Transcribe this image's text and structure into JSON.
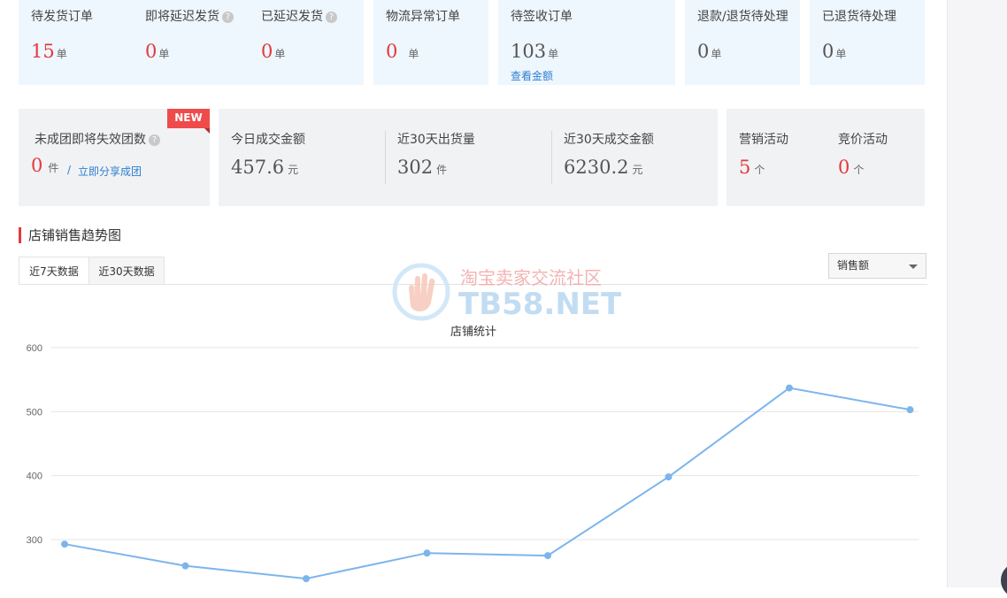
{
  "order_stats": [
    {
      "label": "待发货订单",
      "value": "15",
      "unit": "单",
      "help": false,
      "color": "red"
    },
    {
      "label": "即将延迟发货",
      "value": "0",
      "unit": "单",
      "help": true,
      "color": "red"
    },
    {
      "label": "已延迟发货",
      "value": "0",
      "unit": "单",
      "help": true,
      "color": "red"
    },
    {
      "label": "物流异常订单",
      "value": "0",
      "unit": "单",
      "help": false,
      "color": "red"
    },
    {
      "label": "待签收订单",
      "value": "103",
      "unit": "单",
      "help": false,
      "color": "gray",
      "link": "查看金额"
    },
    {
      "label": "退款/退货待处理",
      "value": "0",
      "unit": "单",
      "help": false,
      "color": "gray"
    },
    {
      "label": "已退货待处理",
      "value": "0",
      "unit": "单",
      "help": false,
      "color": "gray"
    }
  ],
  "group_buy": {
    "badge": "NEW",
    "label": "未成团即将失效团数",
    "value": "0",
    "unit": "件",
    "separator": "/",
    "link": "立即分享成团"
  },
  "sales_summary": [
    {
      "label": "今日成交金额",
      "value": "457.6",
      "unit": "元"
    },
    {
      "label": "近30天出货量",
      "value": "302",
      "unit": "件"
    },
    {
      "label": "近30天成交金额",
      "value": "6230.2",
      "unit": "元"
    }
  ],
  "activities": [
    {
      "label": "营销活动",
      "value": "5",
      "unit": "个"
    },
    {
      "label": "竞价活动",
      "value": "0",
      "unit": "个"
    }
  ],
  "trend": {
    "title": "店铺销售趋势图",
    "tabs": [
      {
        "label": "近7天数据",
        "active": true
      },
      {
        "label": "近30天数据",
        "active": false
      }
    ],
    "metric_select": "销售额"
  },
  "watermark": {
    "line1": "淘宝卖家交流社区",
    "line2": "TB58.NET"
  },
  "chart_data": {
    "type": "line",
    "title": "店铺统计",
    "y_ticks": [
      300,
      400,
      500,
      600
    ],
    "ylim": [
      260,
      630
    ],
    "grid": true,
    "series": [
      {
        "values": [
          293,
          259,
          239,
          279,
          275,
          398,
          537,
          503
        ]
      }
    ],
    "color": "#7cb5ec"
  },
  "colors": {
    "accent": "#e4393c",
    "link": "#2d7fd0",
    "card_blue": "#eef6fe",
    "card_gray": "#f1f2f4"
  }
}
